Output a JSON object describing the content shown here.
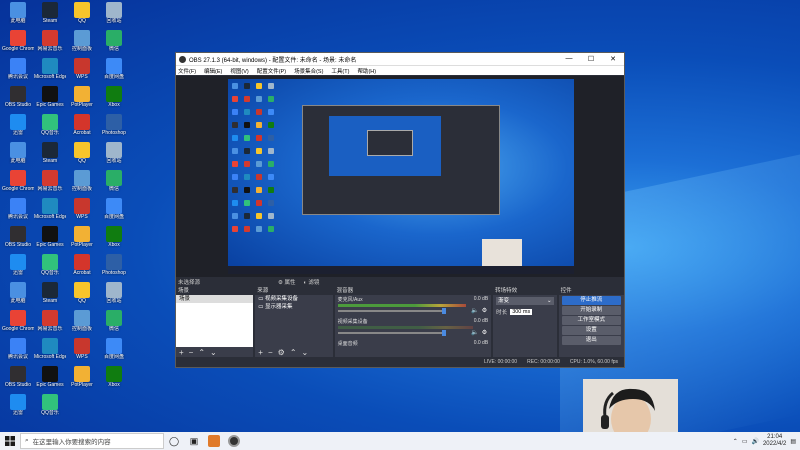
{
  "obs": {
    "title": "OBS 27.1.3 (64-bit, windows) - 配置文件: 未命名 - 场景: 未命名",
    "menu": [
      "文件(F)",
      "编辑(E)",
      "视图(V)",
      "配置文件(P)",
      "场景集合(S)",
      "工具(T)",
      "帮助(H)"
    ],
    "no_source_selected": "未选择源",
    "properties_btn": "属性",
    "filters_btn": "滤镜",
    "scenes_header": "场景",
    "scene_item": "场景",
    "sources_header": "来源",
    "sources": [
      "视频采集设备",
      "显示器采集"
    ],
    "mixer_header": "混音器",
    "mixer": [
      {
        "name": "麦克风/Aux",
        "db": "0.0 dB",
        "level": 0.85
      },
      {
        "name": "视频采集设备",
        "db": "0.0 dB",
        "level": 0.0
      },
      {
        "name": "桌面音频",
        "db": "0.0 dB",
        "level": 0.0
      }
    ],
    "transition_header": "转场特效",
    "transition_value": "渐变",
    "duration_label": "时长",
    "duration_value": "300 ms",
    "controls_header": "控件",
    "controls": [
      "停止推流",
      "开始录制",
      "工作室模式",
      "设置",
      "退出"
    ],
    "status": {
      "live": "LIVE: 00:00:00",
      "rec": "REC: 00:00:00",
      "cpu": "CPU: 1.0%, 60.00 fps"
    }
  },
  "taskbar": {
    "search_placeholder": "在这里输入你要搜索的内容",
    "time": "21:04",
    "date": "2022/4/2"
  },
  "desktop_icons": [
    "此电脑",
    "Steam",
    "QQ",
    "回收站",
    "Google Chrome",
    "网易云音乐",
    "控制面板",
    "微信",
    "腾讯会议",
    "Microsoft Edge",
    "WPS",
    "百度网盘",
    "OBS Studio",
    "Epic Games",
    "PotPlayer",
    "Xbox",
    "迅雷",
    "QQ音乐",
    "Acrobat",
    "Photoshop"
  ],
  "colors": {
    "accent": "#2d6cc9",
    "desktop": "#0a4db8",
    "obs_bg": "#2b2e38"
  }
}
